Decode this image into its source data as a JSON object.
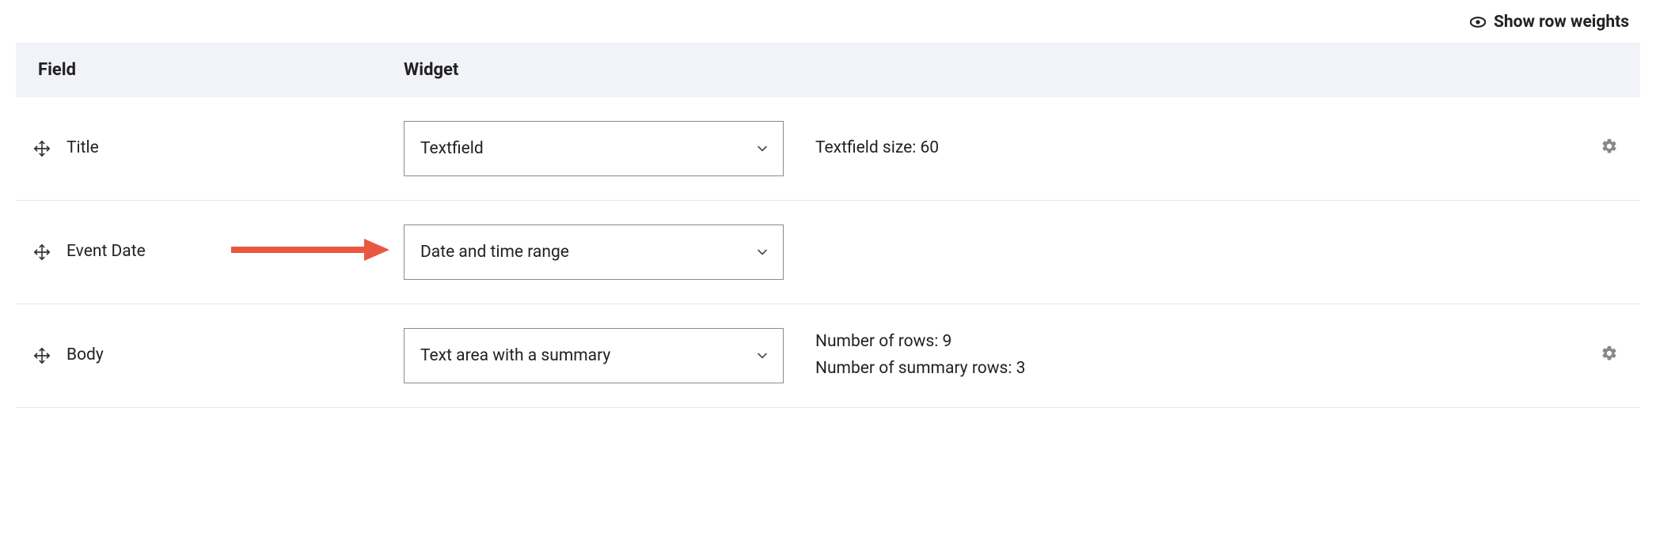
{
  "toggle": {
    "label": "Show row weights"
  },
  "headers": {
    "field": "Field",
    "widget": "Widget"
  },
  "rows": [
    {
      "field": "Title",
      "widget": "Textfield",
      "summary1": "Textfield size: 60",
      "summary2": "",
      "has_gear": true,
      "has_arrow": false
    },
    {
      "field": "Event Date",
      "widget": "Date and time range",
      "summary1": "",
      "summary2": "",
      "has_gear": false,
      "has_arrow": true
    },
    {
      "field": "Body",
      "widget": "Text area with a summary",
      "summary1": "Number of rows: 9",
      "summary2": "Number of summary rows: 3",
      "has_gear": true,
      "has_arrow": false
    }
  ]
}
